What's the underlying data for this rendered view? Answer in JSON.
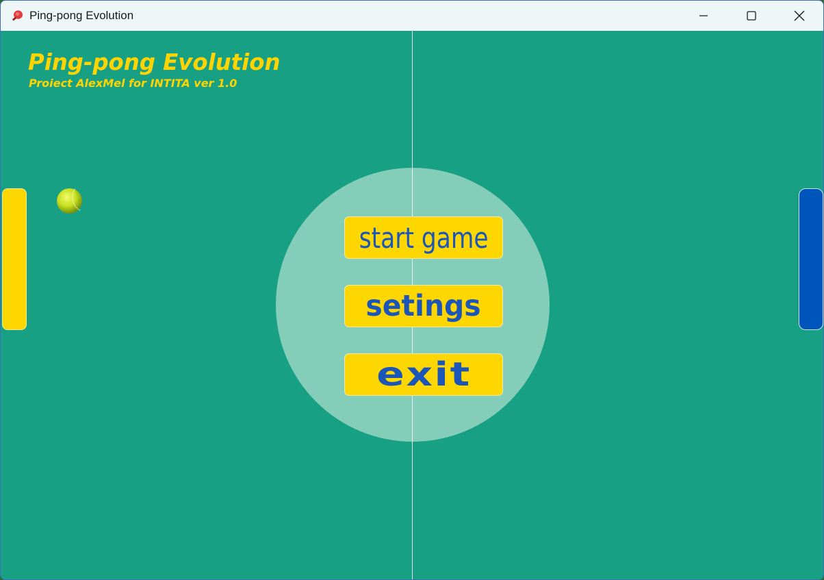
{
  "window": {
    "title": "Ping-pong Evolution",
    "app_icon": "ping-pong-paddle-icon",
    "controls": {
      "minimize_icon": "minimize-icon",
      "maximize_icon": "maximize-icon",
      "close_icon": "close-icon"
    }
  },
  "game": {
    "title": "Ping-pong Evolution",
    "subtitle": "Proiect AlexMel for INTITA ver 1.0",
    "menu": {
      "start_label": "start game",
      "settings_label": "setings",
      "exit_label": "exit"
    },
    "colors": {
      "field": "#17a084",
      "center_circle": "#84cdb8",
      "title_text": "#ffd400",
      "button_bg": "#ffd700",
      "button_text": "#1b56b8",
      "left_paddle": "#ffd700",
      "right_paddle": "#0055bb",
      "ball": "#c8e020"
    },
    "objects": {
      "ball_icon": "tennis-ball-icon"
    }
  }
}
